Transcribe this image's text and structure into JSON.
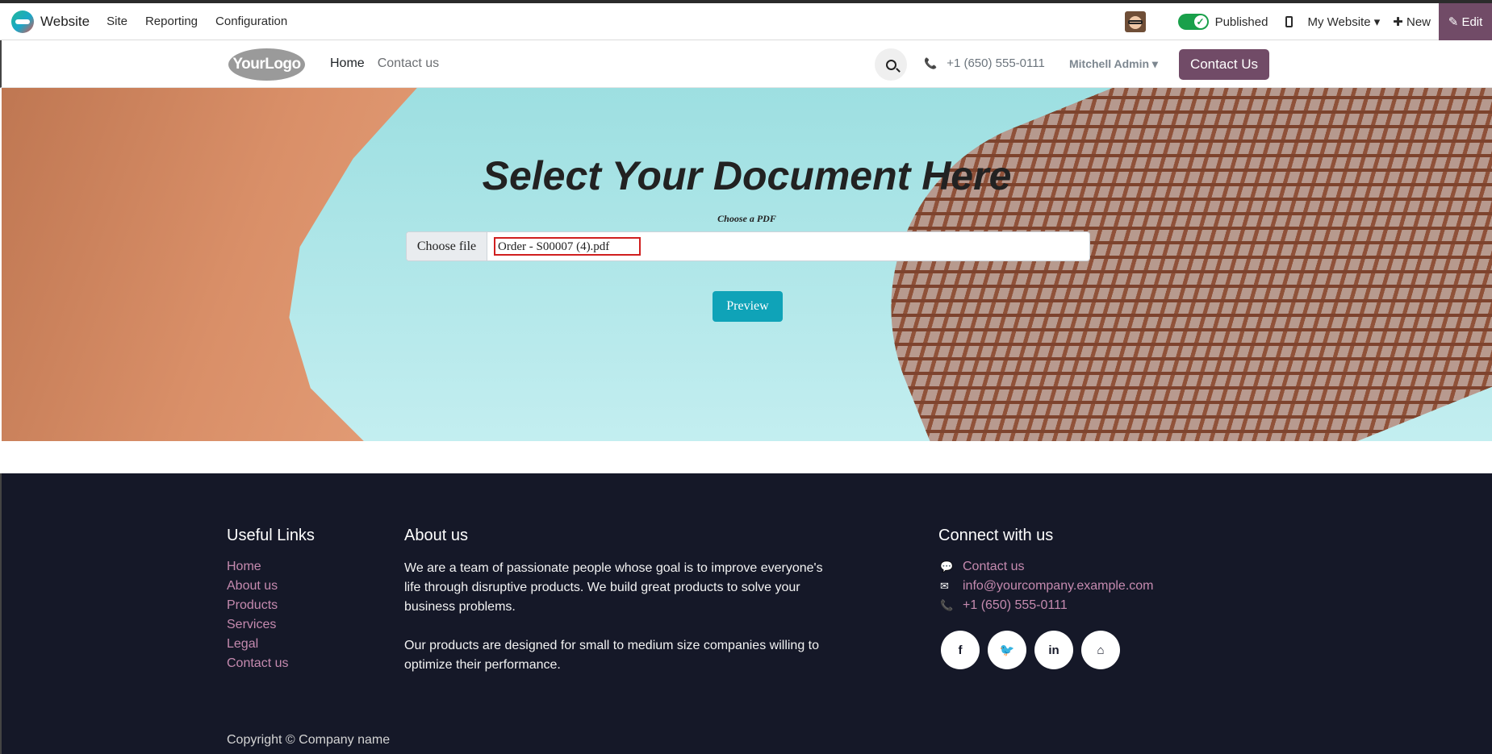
{
  "admin_bar": {
    "app_name": "Website",
    "menu": [
      "Site",
      "Reporting",
      "Configuration"
    ],
    "published_label": "Published",
    "website_selector": "My Website ▾",
    "new_label": "✚ New",
    "edit_label": "✎ Edit",
    "accent_color": "#714b67",
    "toggle_color": "#19a04a"
  },
  "header": {
    "logo_text": "YourLogo",
    "nav": [
      {
        "label": "Home",
        "active": true
      },
      {
        "label": "Contact us",
        "active": false
      }
    ],
    "phone": "+1 (650) 555-0111",
    "user": "Mitchell Admin ▾",
    "cta_label": "Contact Us"
  },
  "hero": {
    "title": "Select Your Document Here",
    "file_label": "Choose a PDF",
    "choose_button": "Choose file",
    "file_name": "Order - S00007 (4).pdf",
    "preview_button": "Preview",
    "preview_color": "#0fa3b8"
  },
  "footer": {
    "useful_links_title": "Useful Links",
    "useful_links": [
      "Home",
      "About us",
      "Products",
      "Services",
      "Legal",
      "Contact us"
    ],
    "about_title": "About us",
    "about_p1": "We are a team of passionate people whose goal is to improve everyone's life through disruptive products. We build great products to solve your business problems.",
    "about_p2": "Our products are designed for small to medium size companies willing to optimize their performance.",
    "connect_title": "Connect with us",
    "contact_links": [
      {
        "icon": "comment-icon",
        "label": "Contact us"
      },
      {
        "icon": "envelope-icon",
        "label": "info@yourcompany.example.com"
      },
      {
        "icon": "phone-icon",
        "label": "+1 (650) 555-0111"
      }
    ],
    "socials": [
      {
        "icon": "facebook-icon",
        "glyph": "f"
      },
      {
        "icon": "twitter-icon",
        "glyph": "🐦"
      },
      {
        "icon": "linkedin-icon",
        "glyph": "in"
      },
      {
        "icon": "home-icon",
        "glyph": "⌂"
      }
    ],
    "copyright": "Copyright © Company name",
    "background_color": "#151828",
    "link_color": "#c58aaf"
  }
}
